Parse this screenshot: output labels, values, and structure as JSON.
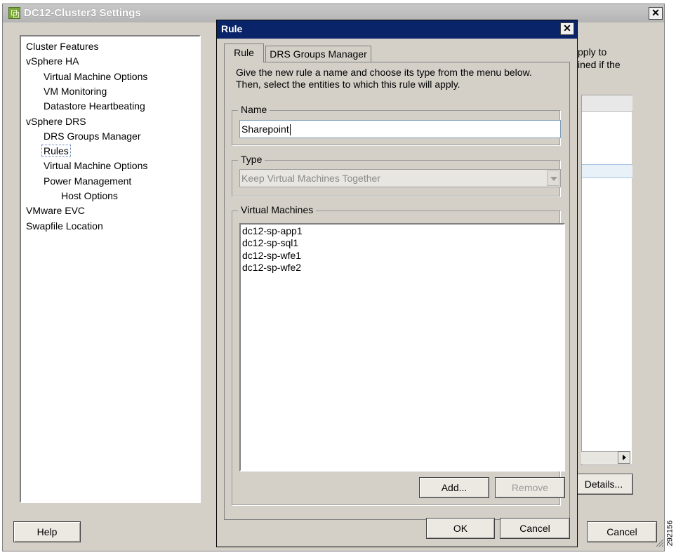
{
  "outer_window": {
    "title": "DC12-Cluster3 Settings",
    "close_glyph": "✕",
    "nav_items": [
      {
        "label": "Cluster Features",
        "level": 0
      },
      {
        "label": "vSphere HA",
        "level": 0
      },
      {
        "label": "Virtual Machine Options",
        "level": 1
      },
      {
        "label": "VM Monitoring",
        "level": 1
      },
      {
        "label": "Datastore Heartbeating",
        "level": 1
      },
      {
        "label": "vSphere DRS",
        "level": 0
      },
      {
        "label": "DRS Groups Manager",
        "level": 1
      },
      {
        "label": "Rules",
        "level": 1,
        "selected": true
      },
      {
        "label": "Virtual Machine Options",
        "level": 1
      },
      {
        "label": "Power Management",
        "level": 1
      },
      {
        "label": "Host Options",
        "level": 2
      },
      {
        "label": "VMware EVC",
        "level": 0
      },
      {
        "label": "Swapfile Location",
        "level": 0
      }
    ],
    "bg_text_line1": "pply to",
    "bg_text_line2": "ined if the",
    "details_button": "Details...",
    "help_button": "Help",
    "cancel_button": "Cancel"
  },
  "rule_dialog": {
    "title": "Rule",
    "close_glyph": "✕",
    "tabs": [
      {
        "label": "Rule",
        "active": true
      },
      {
        "label": "DRS Groups Manager",
        "active": false
      }
    ],
    "instructions_line1": "Give the new rule a name and choose its type from the menu below.",
    "instructions_line2": "Then, select the entities to which this rule will apply.",
    "name_group_label": "Name",
    "name_value": "Sharepoint",
    "type_group_label": "Type",
    "type_value": "Keep Virtual Machines Together",
    "vms_group_label": "Virtual Machines",
    "virtual_machines": [
      "dc12-sp-app1",
      "dc12-sp-sql1",
      "dc12-sp-wfe1",
      "dc12-sp-wfe2"
    ],
    "add_button": "Add...",
    "remove_button": "Remove",
    "ok_button": "OK",
    "cancel_button": "Cancel"
  },
  "figure_id": "292156",
  "colors": {
    "dialog_face": "#d4d0c8",
    "title_bar_active": "#0a246a",
    "outer_title_bar": "#b4b4b4",
    "disabled_text": "#8a8a8a"
  },
  "icons": {
    "app": "vsphere-cluster-icon",
    "close": "close-icon",
    "dropdown": "chevron-down-icon",
    "scroll_right": "arrow-right-icon",
    "resize": "resize-grip-icon"
  }
}
